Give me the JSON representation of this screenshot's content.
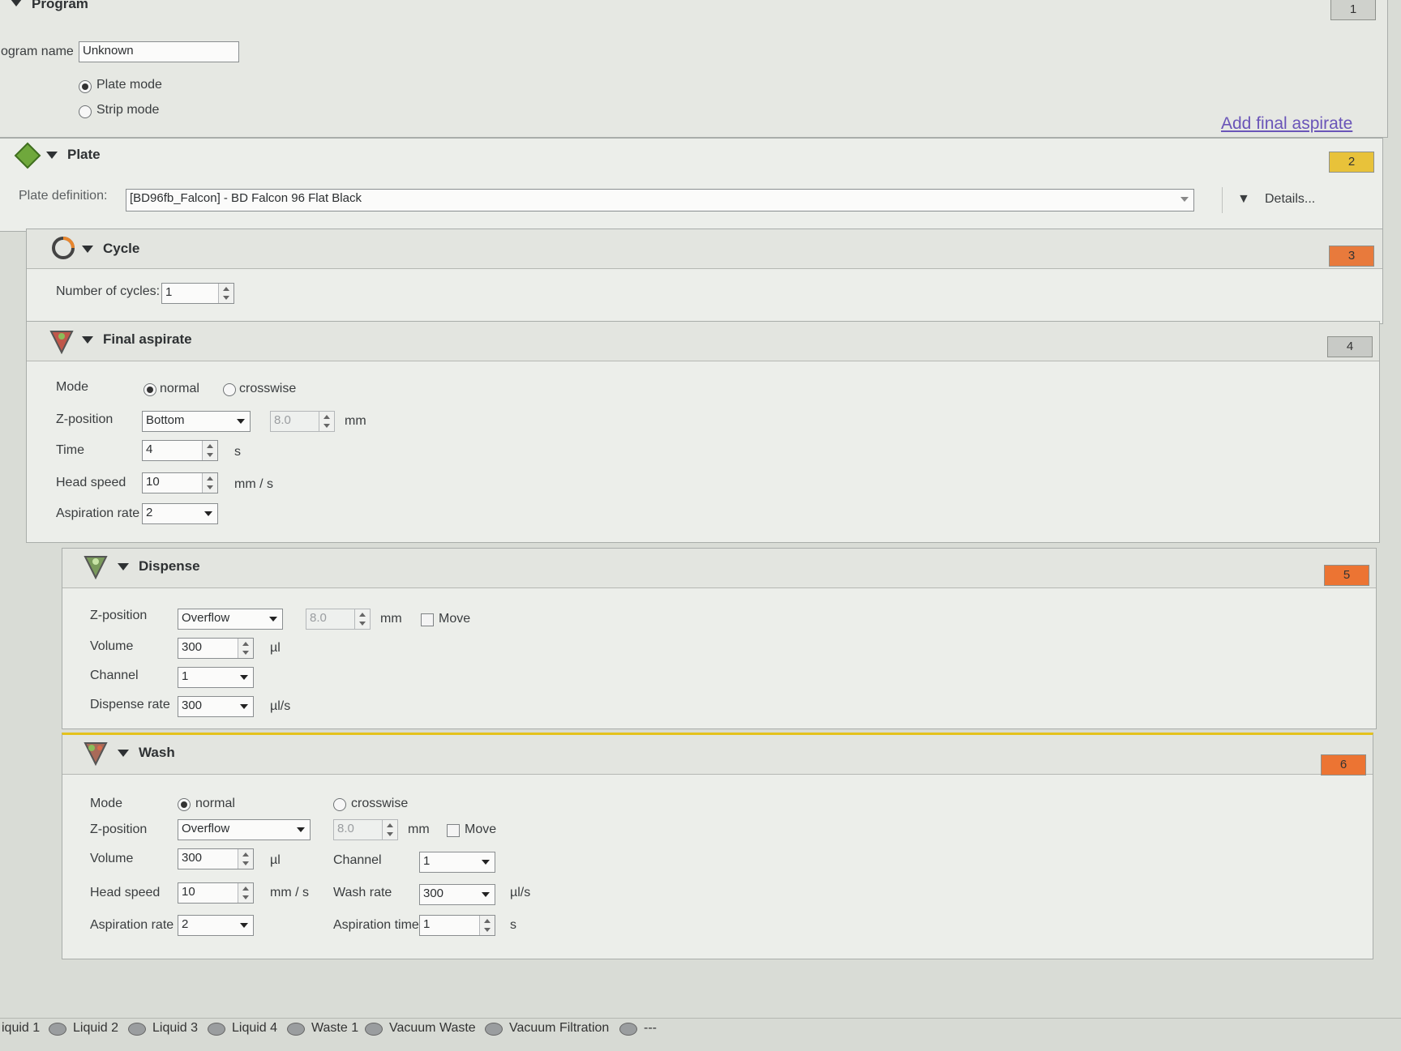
{
  "program": {
    "title": "Program",
    "badge": "1",
    "name_label": "ogram name",
    "name_value": "Unknown",
    "mode_plate": "Plate mode",
    "mode_strip": "Strip mode",
    "add_final_aspirate": "Add final aspirate"
  },
  "plate": {
    "title": "Plate",
    "badge": "2",
    "badge_color": "#e8c23a",
    "definition_label": "Plate definition:",
    "definition_value": "[BD96fb_Falcon] - BD Falcon 96 Flat Black",
    "details_label": "Details..."
  },
  "cycle": {
    "title": "Cycle",
    "badge": "3",
    "badge_color": "#e87a3c",
    "cycles_label": "Number of cycles:",
    "cycles_value": "1"
  },
  "final_aspirate": {
    "title": "Final aspirate",
    "badge": "4",
    "badge_color": "#c8cac6",
    "mode_label": "Mode",
    "mode_normal": "normal",
    "mode_crosswise": "crosswise",
    "zpos_label": "Z-position",
    "zpos_value": "Bottom",
    "zpos_mm": "8.0",
    "mm_unit": "mm",
    "time_label": "Time",
    "time_value": "4",
    "time_unit": "s",
    "speed_label": "Head speed",
    "speed_value": "10",
    "speed_unit": "mm / s",
    "asp_rate_label": "Aspiration rate",
    "asp_rate_value": "2"
  },
  "dispense": {
    "title": "Dispense",
    "badge": "5",
    "badge_color": "#ec7433",
    "zpos_label": "Z-position",
    "zpos_value": "Overflow",
    "zpos_mm": "8.0",
    "mm_unit": "mm",
    "move_label": "Move",
    "volume_label": "Volume",
    "volume_value": "300",
    "volume_unit": "µl",
    "channel_label": "Channel",
    "channel_value": "1",
    "rate_label": "Dispense rate",
    "rate_value": "300",
    "rate_unit": "µl/s"
  },
  "wash": {
    "title": "Wash",
    "badge": "6",
    "badge_color": "#ec7433",
    "mode_label": "Mode",
    "mode_normal": "normal",
    "mode_crosswise": "crosswise",
    "zpos_label": "Z-position",
    "zpos_value": "Overflow",
    "zpos_mm": "8.0",
    "mm_unit": "mm",
    "move_label": "Move",
    "volume_label": "Volume",
    "volume_value": "300",
    "volume_unit": "µl",
    "channel_label": "Channel",
    "channel_value": "1",
    "speed_label": "Head speed",
    "speed_value": "10",
    "speed_unit": "mm / s",
    "wash_rate_label": "Wash rate",
    "wash_rate_value": "300",
    "wash_rate_unit": "µl/s",
    "asp_rate_label": "Aspiration rate",
    "asp_rate_value": "2",
    "asp_time_label": "Aspiration time",
    "asp_time_value": "1",
    "asp_time_unit": "s"
  },
  "liquids": {
    "l1": "iquid 1",
    "l2": "Liquid 2",
    "l3": "Liquid 3",
    "l4": "Liquid 4",
    "waste1": "Waste 1",
    "vac_waste": "Vacuum Waste",
    "vac_filt": "Vacuum Filtration",
    "more": "---"
  }
}
